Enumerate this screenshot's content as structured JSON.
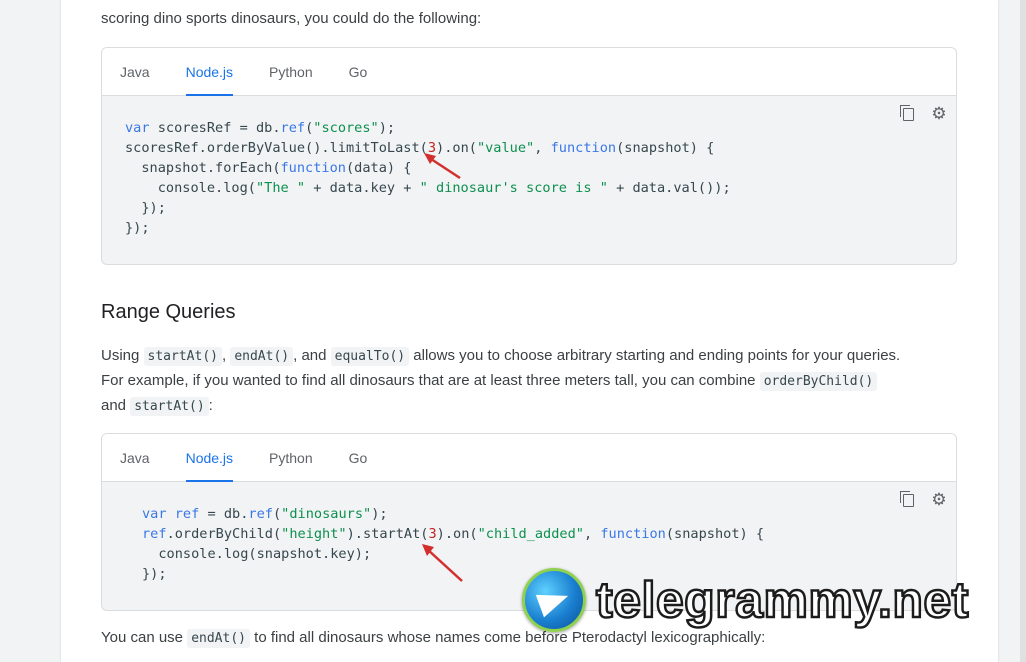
{
  "intro": {
    "line2": "scoring dino sports dinosaurs, you could do the following:"
  },
  "code1": {
    "tabs": [
      "Java",
      "Node.js",
      "Python",
      "Go"
    ],
    "active_tab": "Node.js"
  },
  "section": {
    "title": "Range Queries"
  },
  "para1": {
    "p1": "Using ",
    "c1": "startAt()",
    "p2": ", ",
    "c2": "endAt()",
    "p3": ", and ",
    "c3": "equalTo()",
    "p4": " allows you to choose arbitrary starting and ending points for your queries.",
    "p5": "For example, if you wanted to find all dinosaurs that are at least three meters tall, you can combine ",
    "c4": "orderByChild()",
    "p6": "and ",
    "c5": "startAt()",
    "p7": ":"
  },
  "code2": {
    "tabs": [
      "Java",
      "Node.js",
      "Python",
      "Go"
    ],
    "active_tab": "Node.js"
  },
  "para2": {
    "p1": "You can use ",
    "c1": "endAt()",
    "p2": " to find all dinosaurs whose names come before Pterodactyl lexicographically:"
  },
  "icons": {
    "copy": "copy-icon",
    "theme": "dark-theme-toggle-icon"
  },
  "watermark": {
    "text": "telegrammy.net"
  },
  "colors": {
    "accent": "#1a73e8",
    "keyword": "#3b78e7",
    "string": "#0d904f",
    "number": "#c5221f",
    "arrow": "#d32f2f"
  }
}
